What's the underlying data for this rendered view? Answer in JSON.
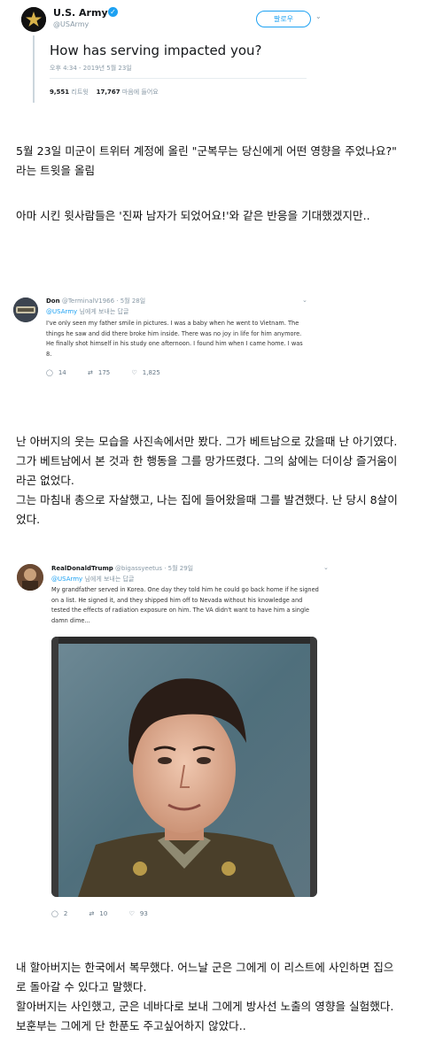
{
  "tweet1": {
    "name": "U.S. Army",
    "handle": "@USArmy",
    "follow_label": "팔로우",
    "text": "How has serving impacted you?",
    "timestamp": "오후 4:34 - 2019년 5월 23일",
    "retweets": "9,551",
    "retweets_label": "리트윗",
    "likes": "17,767",
    "likes_label": "마음에 들어요"
  },
  "para1": "5월 23일 미군이 트위터 계정에 올린 \"군복무는 당신에게 어떤 영향을 주었나요?\"\n라는 트윗을 올림",
  "para2": "아마 시킨 윗사람들은 '진짜 남자가 되었어요!'와 같은 반응을 기대했겠지만..",
  "tweet2": {
    "name": "Don",
    "meta": "@TerminalV1966 · 5월 28일",
    "reply_handle": "@USArmy",
    "reply_suffix": "님에게 보내는 답글",
    "text": "I've only seen my father smile in pictures. I was a baby when he went to Vietnam. The things he saw and did there broke him inside. There was no joy in life for him anymore. He finally shot himself in his study one afternoon. I found him when I came home. I was 8.",
    "replies": "14",
    "retweets": "175",
    "likes": "1,825"
  },
  "para3": "난 아버지의 웃는 모습을 사진속에서만 봤다. 그가 베트남으로 갔을때 난 아기였다.\n그가 베트남에서 본 것과 한 행동을 그를 망가뜨렸다. 그의 삶에는 더이상 즐거움이\n라곤 없었다.\n그는 마침내 총으로 자살했고, 나는 집에 들어왔을때 그를 발견했다. 난 당시 8살이\n었다.",
  "tweet3": {
    "name": "RealDonaldTrump",
    "meta": "@bigassyeetus · 5월 29일",
    "reply_handle": "@USArmy",
    "reply_suffix": "님에게 보내는 답글",
    "text": "My grandfather served in Korea. One day they told him he could go back home if he signed on a list. He signed it, and they shipped him off to Nevada without his knowledge and tested the effects of radiation exposure on him. The VA didn't want to have him a single damn dime...",
    "replies": "2",
    "retweets": "10",
    "likes": "93"
  },
  "para4": "내 할아버지는 한국에서 복무했다. 어느날 군은 그에게 이 리스트에 사인하면 집으\n로 돌아갈 수 있다고 말했다.\n할아버지는 사인했고, 군은 네바다로 보내 그에게 방사선 노출의 영향을 실험했다.\n보훈부는 그에게 단 한푼도 주고싶어하지 않았다..",
  "icons": {
    "reply": "reply-icon",
    "retweet": "retweet-icon",
    "like": "heart-icon",
    "chevron": "chevron-down-icon",
    "verified": "verified-icon"
  },
  "colors": {
    "twitter_blue": "#1da1f2",
    "muted": "#8899a6"
  }
}
